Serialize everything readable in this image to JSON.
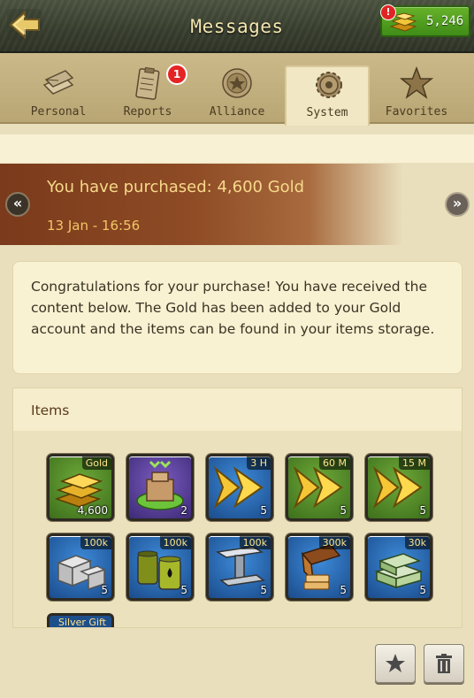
{
  "header": {
    "title": "Messages",
    "gold_amount": "5,246",
    "gold_alert": "!",
    "back_icon": "back-arrow-icon"
  },
  "tabs": [
    {
      "label": "Personal",
      "icon": "letters-icon",
      "active": false
    },
    {
      "label": "Reports",
      "icon": "clipboard-icon",
      "active": false,
      "badge": "1"
    },
    {
      "label": "Alliance",
      "icon": "alliance-emblem-icon",
      "active": false
    },
    {
      "label": "System",
      "icon": "gear-icon",
      "active": true
    },
    {
      "label": "Favorites",
      "icon": "star-icon",
      "active": false
    }
  ],
  "message": {
    "subject": "You have purchased: 4,600 Gold",
    "date": "13 Jan - 16:56",
    "prev_label": "«",
    "next_label": "»",
    "body": "Congratulations for your purchase! You have received the content below. The Gold has been added to your Gold account and the items can be found in your items storage."
  },
  "items_section": {
    "title": "Items",
    "items": [
      {
        "name": "gold",
        "tag": "Gold",
        "qty": "4,600",
        "icon": "gold-bars-icon"
      },
      {
        "name": "building",
        "tag": "",
        "qty": "2",
        "icon": "building-upgrade-icon"
      },
      {
        "name": "speedup-3h",
        "tag": "3 H",
        "qty": "5",
        "icon": "speedup-arrows-icon"
      },
      {
        "name": "speedup-60m",
        "tag": "60 M",
        "qty": "5",
        "icon": "speedup-arrows-icon"
      },
      {
        "name": "speedup-15m",
        "tag": "15 M",
        "qty": "5",
        "icon": "speedup-arrows-icon"
      },
      {
        "name": "stone",
        "tag": "100k",
        "qty": "5",
        "icon": "stone-blocks-icon"
      },
      {
        "name": "oil",
        "tag": "100k",
        "qty": "5",
        "icon": "oil-barrels-icon"
      },
      {
        "name": "iron",
        "tag": "100k",
        "qty": "5",
        "icon": "iron-beam-icon"
      },
      {
        "name": "food",
        "tag": "300k",
        "qty": "5",
        "icon": "bread-icon"
      },
      {
        "name": "cash",
        "tag": "30k",
        "qty": "5",
        "icon": "cash-stack-icon"
      }
    ],
    "partial_item_label": "Silver Gift"
  },
  "actions": {
    "favorite_icon": "star-icon",
    "delete_icon": "trash-icon"
  },
  "colors": {
    "header_bg": "#3a4030",
    "gold_green": "#4f9d1f",
    "banner_brown": "#7a3a1b",
    "subject_gold": "#f7d98a",
    "badge_red": "#e42424"
  }
}
